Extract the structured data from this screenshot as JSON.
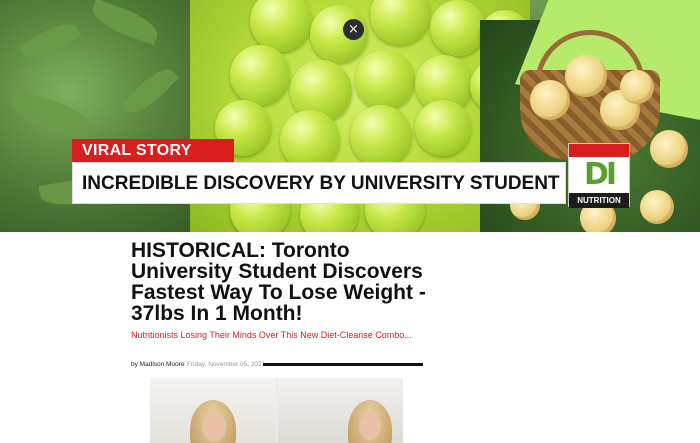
{
  "banner": {
    "tag": "VIRAL STORY",
    "headline": "INCREDIBLE DISCOVERY BY UNIVERSITY STUDENT",
    "close_icon": "close-icon",
    "close_glyph": "×",
    "logo": {
      "mark": "DI",
      "name": "NUTRITION"
    }
  },
  "article": {
    "title": "HISTORICAL: Toronto University Student Discovers Fastest Way To Lose Weight - 37lbs In 1 Month!",
    "subtitle": "Nutritionists Losing Their Minds Over This New Diet-Cleanse Combo...",
    "author": "by Madison Moore",
    "date": "Friday, November 05, 2021"
  },
  "colors": {
    "accent_red": "#d81e1e",
    "logo_green": "#5aa02c",
    "text": "#111111"
  }
}
